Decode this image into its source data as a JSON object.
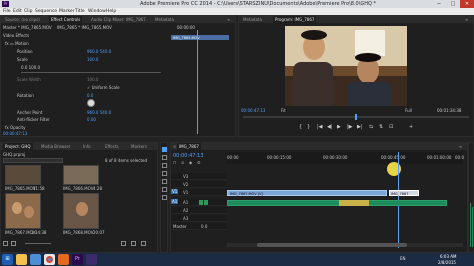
{
  "window": {
    "app_badge": "Pr",
    "title": "Adobe Premiere Pro CC 2014 - C:\\Users\\STARSZINU\\Documents\\Adobe\\Premiere Pro\\8.0\\GHQ *",
    "minimize": "─",
    "maximize": "□",
    "close": "✕"
  },
  "menu": [
    "File",
    "Edit",
    "Clip",
    "Sequence",
    "Marker",
    "Title",
    "Window",
    "Help"
  ],
  "source_panel": {
    "tabs": [
      "Source: (no clips)",
      "Effect Controls",
      "Audio Clip Mixer: IMG_7867",
      "Metadata"
    ],
    "active_tab": 1,
    "menu_icon": "≡",
    "header_path": "Master * IMG_7865.MOV",
    "header_clip": "IMG_7865 * IMG_7865.MOV",
    "ruler_time": "00:00:00",
    "clip_bar": "IMG_7865.MOV",
    "rows": [
      {
        "label": "Video Effects",
        "value": ""
      },
      {
        "label": "fx  ▭ Motion",
        "value": ""
      },
      {
        "label": "Position",
        "value": "960.0    540.0"
      },
      {
        "label": "Scale",
        "value": "100.0"
      },
      {
        "label": "",
        "value": "0.0        100.0"
      },
      {
        "label": "Scale Width",
        "value": "100.0"
      },
      {
        "label": "",
        "value": "✓ Uniform Scale"
      },
      {
        "label": "Rotation",
        "value": "0.0"
      },
      {
        "label": "Anchor Point",
        "value": "960.0    540.0"
      },
      {
        "label": "Anti-flicker Filter",
        "value": "0.00"
      },
      {
        "label": "fx  Opacity",
        "value": ""
      }
    ],
    "timecode": "00:00:47:13"
  },
  "program_panel": {
    "tabs": [
      "Metadata",
      "Program: IMG_7867",
      "≡"
    ],
    "active_tab": 1,
    "timecode": "00:00:47:13",
    "fit": "Fit",
    "full": "Full",
    "duration": "00:01:34:38",
    "transport": [
      "{",
      "}",
      "|◀",
      "◀|",
      "▶",
      "|▶",
      "▶|",
      "⇆",
      "⇅",
      "⊡",
      "+"
    ]
  },
  "project_panel": {
    "tabs": [
      "Project: GHQ",
      "Media Browser",
      "Info",
      "Effects",
      "Markers"
    ],
    "active_tab": 0,
    "breadcrumb": "GHQ.prproj",
    "item_count": "8 of 8 items selected",
    "items": [
      {
        "name": "IMG_7865.MOV",
        "dur": "11:58"
      },
      {
        "name": "IMG_7866.MOV",
        "dur": "4:28"
      },
      {
        "name": "IMG_7867.MOV",
        "dur": "1:34:38"
      },
      {
        "name": "IMG_7868.MOV",
        "dur": "20:07"
      }
    ]
  },
  "timeline_panel": {
    "close_icon": "×",
    "sequence_tab": "IMG_7867",
    "menu_icon": "≡",
    "timecode": "00:00:47:13",
    "ruler": [
      "00:00",
      "00:00:15:00",
      "00:00:30:00",
      "00:00:45:00",
      "00:01:00:00",
      "00:0"
    ],
    "video_tracks": [
      "V3",
      "V2",
      "V1"
    ],
    "audio_tracks": [
      "A1",
      "A2",
      "A3"
    ],
    "patch_left": "V1",
    "patch_audio": "A1",
    "clip_label": "IMG_7867.MOV [V]",
    "clip_label_2": "IMG_7867",
    "master": "Master",
    "master_value": "0.0"
  },
  "taskbar": {
    "icons": [
      "Start",
      "Explorer",
      "Media",
      "Chrome",
      "Firefox",
      "Premiere",
      "Pr",
      "App"
    ],
    "time": "6:03 AM",
    "date": "2/8/2015",
    "tray": "EN"
  },
  "colors": {
    "accent": "#4ea1ff",
    "clip_video": "#7aa7d6",
    "clip_audio": "#1f8a5b",
    "playhead": "#4ea1ff"
  }
}
